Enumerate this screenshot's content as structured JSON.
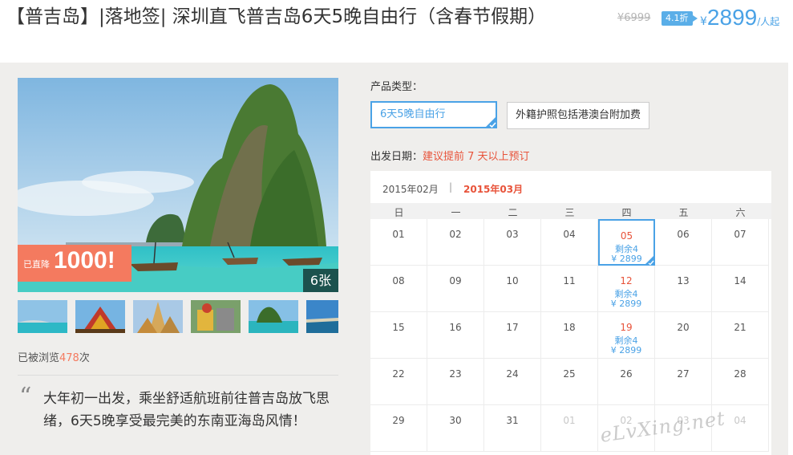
{
  "header": {
    "title": "【普吉岛】|落地签| 深圳直飞普吉岛6天5晚自由行（含春节假期）",
    "old_price": "¥6999",
    "discount": "4.1折",
    "price_symbol": "¥",
    "price": "2899",
    "price_unit": "/人起"
  },
  "gallery": {
    "promo_prefix": "已直降",
    "promo_amount": "1000!",
    "image_count": "6张",
    "thumbnails": [
      "beach-thumb",
      "temple-thumb",
      "palace-thumb",
      "elephant-thumb",
      "island-thumb",
      "coast-thumb"
    ]
  },
  "stats": {
    "views_prefix": "已被浏览",
    "views_count": "478",
    "views_suffix": "次"
  },
  "intro": {
    "quote_mark": "“",
    "text": "大年初一出发，乘坐舒适航班前往普吉岛放飞思绪，6天5晚享受最完美的东南亚海岛风情！"
  },
  "product": {
    "type_label": "产品类型：",
    "options": [
      "6天5晚自由行",
      "外籍护照包括港澳台附加费"
    ],
    "selected": 0
  },
  "departure": {
    "label": "出发日期：",
    "hint": "建议提前 7 天以上预订"
  },
  "calendar": {
    "months": [
      "2015年02月",
      "2015年03月"
    ],
    "month_separator": "|",
    "active_month": 1,
    "weekdays": [
      "日",
      "一",
      "二",
      "三",
      "四",
      "五",
      "六"
    ],
    "rows": [
      [
        {
          "d": "01"
        },
        {
          "d": "02"
        },
        {
          "d": "03"
        },
        {
          "d": "04"
        },
        {
          "d": "05",
          "avail": "剩余4",
          "price": "¥ 2899",
          "selected": true
        },
        {
          "d": "06"
        },
        {
          "d": "07"
        }
      ],
      [
        {
          "d": "08"
        },
        {
          "d": "09"
        },
        {
          "d": "10"
        },
        {
          "d": "11"
        },
        {
          "d": "12",
          "avail": "剩余4",
          "price": "¥ 2899"
        },
        {
          "d": "13"
        },
        {
          "d": "14"
        }
      ],
      [
        {
          "d": "15"
        },
        {
          "d": "16"
        },
        {
          "d": "17"
        },
        {
          "d": "18"
        },
        {
          "d": "19",
          "avail": "剩余4",
          "price": "¥ 2899"
        },
        {
          "d": "20"
        },
        {
          "d": "21"
        }
      ],
      [
        {
          "d": "22"
        },
        {
          "d": "23"
        },
        {
          "d": "24"
        },
        {
          "d": "25"
        },
        {
          "d": "26"
        },
        {
          "d": "27"
        },
        {
          "d": "28"
        }
      ],
      [
        {
          "d": "29"
        },
        {
          "d": "30"
        },
        {
          "d": "31"
        },
        {
          "d": "01",
          "other": true
        },
        {
          "d": "02",
          "other": true
        },
        {
          "d": "03",
          "other": true
        },
        {
          "d": "04",
          "other": true
        }
      ]
    ]
  },
  "watermark": "eLvXing.net",
  "colors": {
    "accent_blue": "#4aa2e6",
    "promo_red": "#f47a5f",
    "hint_red": "#e8533a",
    "panel_bg": "#efeeec"
  }
}
